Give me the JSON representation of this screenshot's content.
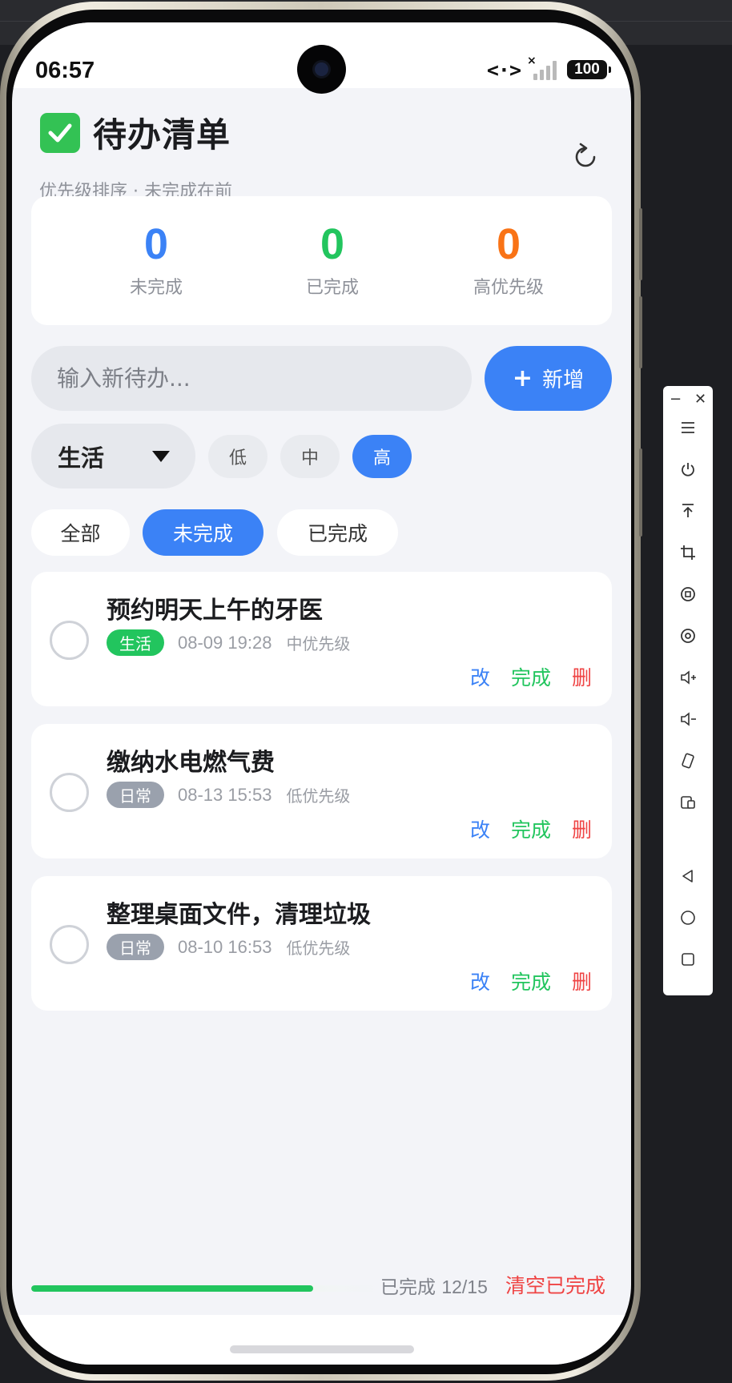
{
  "status_bar": {
    "time": "06:57",
    "battery": "100"
  },
  "header": {
    "title": "待办清单",
    "subtitle": "优先级排序 · 未完成在前"
  },
  "stats": [
    {
      "value": "0",
      "label": "未完成",
      "color": "#3b82f6"
    },
    {
      "value": "0",
      "label": "已完成",
      "color": "#22c55e"
    },
    {
      "value": "0",
      "label": "高优先级",
      "color": "#f97316"
    }
  ],
  "composer": {
    "placeholder": "输入新待办...",
    "add_label": "新增",
    "category": "生活",
    "priorities": [
      "低",
      "中",
      "高"
    ],
    "selected_priority": "高"
  },
  "filters": {
    "tabs": [
      "全部",
      "未完成",
      "已完成"
    ],
    "active": "未完成"
  },
  "todos": [
    {
      "title": "预约明天上午的牙医",
      "category": "生活",
      "category_color": "#22c55e",
      "datetime": "08-09 19:28",
      "priority": "中优先级"
    },
    {
      "title": "缴纳水电燃气费",
      "category": "日常",
      "category_color": "#9aa1ad",
      "datetime": "08-13 15:53",
      "priority": "低优先级"
    },
    {
      "title": "整理桌面文件，清理垃圾",
      "category": "日常",
      "category_color": "#9aa1ad",
      "datetime": "08-10 16:53",
      "priority": "低优先级"
    }
  ],
  "actions": {
    "edit": "改",
    "complete": "完成",
    "delete": "删"
  },
  "footer": {
    "progress_label": "已完成",
    "progress_count": "12/15",
    "progress_fraction": 0.8,
    "clear_label": "清空已完成"
  },
  "colors": {
    "accent": "#3b82f6",
    "success": "#22c55e",
    "danger": "#ef4444",
    "warning": "#f97316"
  }
}
